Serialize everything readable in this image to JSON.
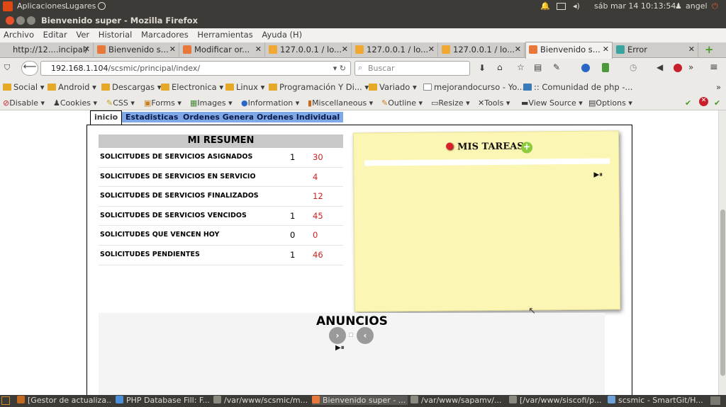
{
  "system": {
    "apps": "Aplicaciones",
    "places": "Lugares",
    "clock": "sáb mar 14 10:13:54",
    "user": "angel"
  },
  "window": {
    "title": "Bienvenido super - Mozilla Firefox"
  },
  "menu": [
    "Archivo",
    "Editar",
    "Ver",
    "Historial",
    "Marcadores",
    "Herramientas",
    "Ayuda (H)"
  ],
  "tabs": [
    {
      "label": "http://12....incipal/",
      "color": "#ffffff"
    },
    {
      "label": "Bienvenido s...",
      "color": "#e8773a"
    },
    {
      "label": "Modificar or...",
      "color": "#e8773a"
    },
    {
      "label": "127.0.0.1 / lo...",
      "color": "#f0a830"
    },
    {
      "label": "127.0.0.1 / lo...",
      "color": "#f0a830"
    },
    {
      "label": "127.0.0.1 / lo...",
      "color": "#f0a830"
    },
    {
      "label": "Bienvenido s...",
      "color": "#e8773a"
    },
    {
      "label": "Error",
      "color": "#3aa4a0"
    }
  ],
  "nav": {
    "url_host": "192.168.1.104",
    "url_path": "/scsmic/principal/index/",
    "search_placeholder": "Buscar"
  },
  "bookmarks": [
    "Social",
    "Android",
    "Descargas",
    "Electronica",
    "Linux",
    "Programación Y Di...",
    "Variado",
    "mejorandocurso - Yo...",
    ":: Comunidad de php -..."
  ],
  "webdev": [
    "Disable",
    "Cookies",
    "CSS",
    "Forms",
    "Images",
    "Information",
    "Miscellaneous",
    "Outline",
    "Resize",
    "Tools",
    "View Source",
    "Options"
  ],
  "page": {
    "tabs": [
      "inicio",
      "Estadisticas",
      "Ordenes General",
      "Ordenes Individual"
    ],
    "resumen": {
      "title": "MI RESUMEN",
      "rows": [
        {
          "label": "SOLICITUDES DE SERVICIOS ASIGNADOS",
          "a": "1",
          "b": "30"
        },
        {
          "label": "SOLICITUDES DE SERVICIOS EN SERVICIO",
          "a": "",
          "b": "4"
        },
        {
          "label": "SOLICITUDES DE SERVICIOS FINALIZADOS",
          "a": "",
          "b": "12"
        },
        {
          "label": "SOLICITUDES DE SERVICIOS VENCIDOS",
          "a": "1",
          "b": "45"
        },
        {
          "label": "SOLICITUDES QUE VENCEN HOY",
          "a": "0",
          "b": "0"
        },
        {
          "label": "SOLICITUDES PENDIENTES",
          "a": "1",
          "b": "46"
        }
      ]
    },
    "tareas_title": "MIS TAREAS",
    "anuncios_title": "ANUNCIOS"
  },
  "taskbar": [
    {
      "label": "[Gestor de actualiza...",
      "color": "#c46a1e"
    },
    {
      "label": "PHP Database Fill: F...",
      "color": "#4a8fd9"
    },
    {
      "label": "/var/www/scsmic/m...",
      "color": "#8a8a80"
    },
    {
      "label": "Bienvenido super - ...",
      "color": "#e8773a"
    },
    {
      "label": "/var/www/sapamv/...",
      "color": "#8a8a80"
    },
    {
      "label": "[/var/www/siscofi/p...",
      "color": "#8a8a80"
    },
    {
      "label": "scsmic - SmartGit/H...",
      "color": "#6fa0d8"
    }
  ]
}
